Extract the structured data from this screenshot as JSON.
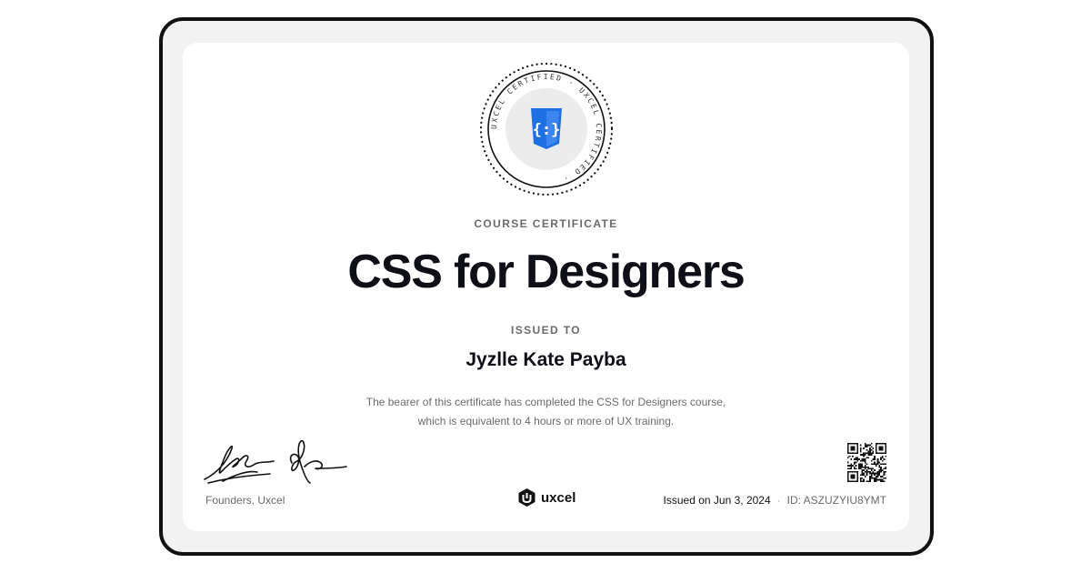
{
  "seal": {
    "ring_text": "UXCEL CERTIFIED · UXCEL CERTIFIED · ",
    "icon": "css-shield-icon",
    "icon_color": "#1f6fe5"
  },
  "certificate": {
    "eyebrow": "COURSE CERTIFICATE",
    "title": "CSS for Designers",
    "issued_to_label": "ISSUED TO",
    "recipient": "Jyzlle Kate Payba",
    "description_line1": "The bearer of this certificate has completed the CSS for Designers course,",
    "description_line2": "which is equivalent to 4 hours or more of UX training."
  },
  "footer": {
    "signatures_caption": "Founders, Uxcel",
    "brand_name": "uxcel",
    "issued_on": "Issued on Jun 3, 2024",
    "credential_id": "ID: ASZUZYIU8YMT"
  },
  "colors": {
    "frame_border": "#111111",
    "frame_fill": "#f2f2f2",
    "card_fill": "#ffffff",
    "title": "#0e0f17",
    "muted": "#6b6b6b"
  }
}
